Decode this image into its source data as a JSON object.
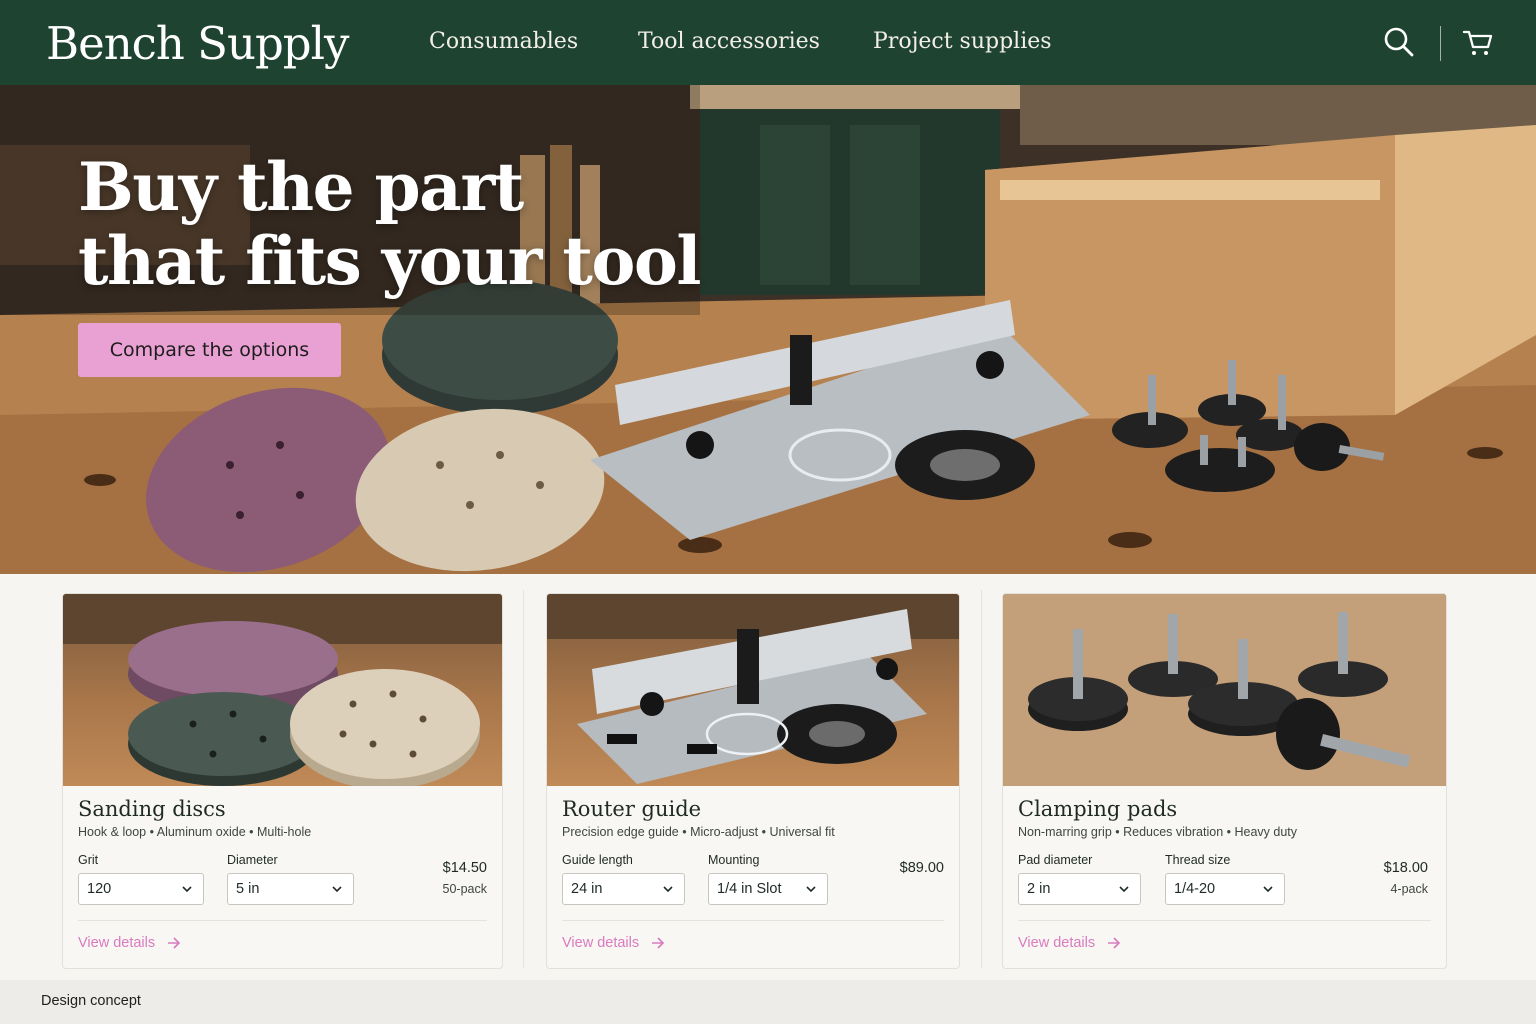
{
  "header": {
    "brand": "Bench Supply",
    "nav": [
      "Consumables",
      "Tool accessories",
      "Project supplies"
    ],
    "icons": [
      "search-icon",
      "cart-icon"
    ]
  },
  "hero": {
    "title_line1": "Buy the part",
    "title_line2": "that fits your tool",
    "cta_label": "Compare the options"
  },
  "products": [
    {
      "title": "Sanding discs",
      "subtitle": "Hook & loop • Aluminum oxide • Multi-hole",
      "options": [
        {
          "label": "Grit",
          "value": "120"
        },
        {
          "label": "Diameter",
          "value": "5 in"
        }
      ],
      "price": "$14.50",
      "pack": "50-pack",
      "link": "View details"
    },
    {
      "title": "Router guide",
      "subtitle": "Precision edge guide • Micro-adjust • Universal fit",
      "options": [
        {
          "label": "Guide length",
          "value": "24 in"
        },
        {
          "label": "Mounting",
          "value": "1/4 in Slot"
        }
      ],
      "price": "$89.00",
      "pack": "",
      "link": "View details"
    },
    {
      "title": "Clamping pads",
      "subtitle": "Non-marring grip • Reduces vibration • Heavy duty",
      "options": [
        {
          "label": "Pad diameter",
          "value": "2 in"
        },
        {
          "label": "Thread size",
          "value": "1/4-20"
        }
      ],
      "price": "$18.00",
      "pack": "4-pack",
      "link": "View details"
    }
  ],
  "footer": {
    "note": "Design concept"
  },
  "colors": {
    "header_bg": "#1e4431",
    "cta_bg": "#e9a1d3",
    "link": "#d87bbf",
    "page_bg": "#f7f5f1"
  }
}
